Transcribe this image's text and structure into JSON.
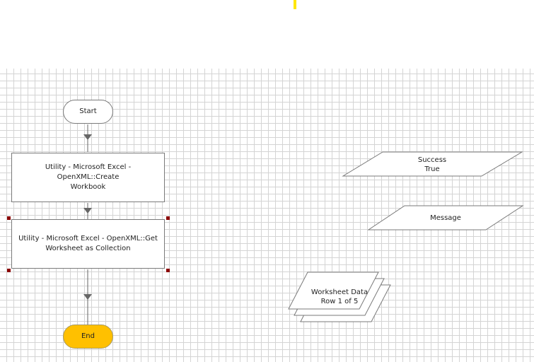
{
  "canvas": {
    "marker_color": "#ffe600",
    "grid_color": "#d4d4d4"
  },
  "stages": {
    "start": {
      "label": "Start"
    },
    "create_workbook": {
      "label": "Utility - Microsoft Excel - OpenXML::Create\nWorkbook"
    },
    "get_worksheet": {
      "label": "Utility - Microsoft Excel - OpenXML::Get\nWorksheet as Collection"
    },
    "end": {
      "label": "End",
      "fill": "#ffc000"
    }
  },
  "data_items": {
    "success": {
      "label": "Success\nTrue"
    },
    "message": {
      "label": "Message"
    },
    "worksheet_data": {
      "label": "Worksheet Data\nRow 1 of 5"
    }
  }
}
